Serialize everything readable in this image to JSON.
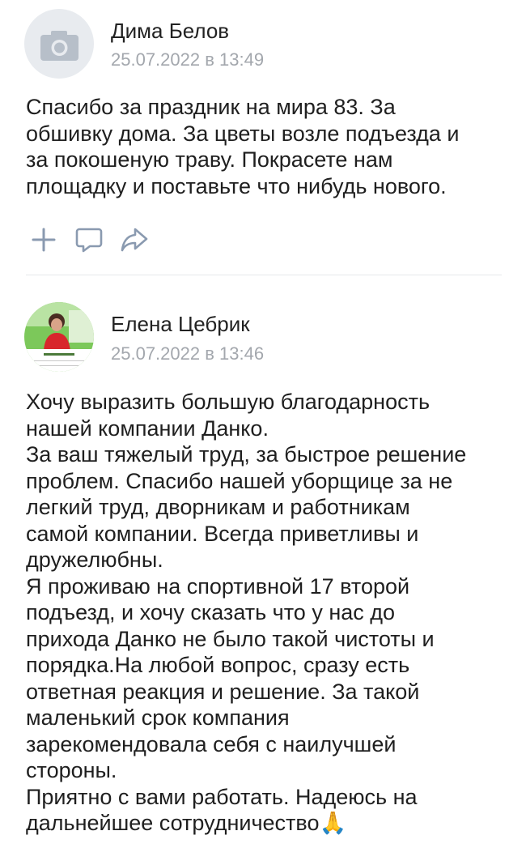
{
  "posts": [
    {
      "author": "Дима Белов",
      "date": "25.07.2022 в 13:49",
      "avatar_icon": "camera-icon",
      "text": "Спасибо за праздник на мира 83. За\nобшивку дома. За цветы возле подъезда и\nза покошеную траву. Покрасете нам\nплощадку и поставьте что нибудь нового.",
      "actions": [
        "plus-icon",
        "comment-icon",
        "share-icon"
      ]
    },
    {
      "author": "Елена Цебрик",
      "date": "25.07.2022 в 13:46",
      "text": "Хочу выразить большую благодарность\nнашей компании Данко.\nЗа ваш тяжелый труд, за быстрое решение\nпроблем. Спасибо нашей уборщице за не\nлегкий труд, дворникам и работникам\nсамой компании. Всегда приветливы и\nдружелюбны.\nЯ проживаю на спортивной 17 второй\nподъезд, и хочу сказать что у нас до\nприхода Данко не было такой чистоты и\nпорядка.На любой вопрос, сразу есть\nответная реакция и решение. За такой\nмаленький срок компания\nзарекомендовала себя с наилучшей\nстороны.\nПриятно с вами работать. Надеюсь на\nдальнейшее сотрудничество🙏"
    }
  ],
  "colors": {
    "text": "#1f1f1f",
    "secondary": "#a3a7ad",
    "icon": "#8a9ab0",
    "divider": "#e6e8ec",
    "avatar_bg": "#e8ebef"
  }
}
